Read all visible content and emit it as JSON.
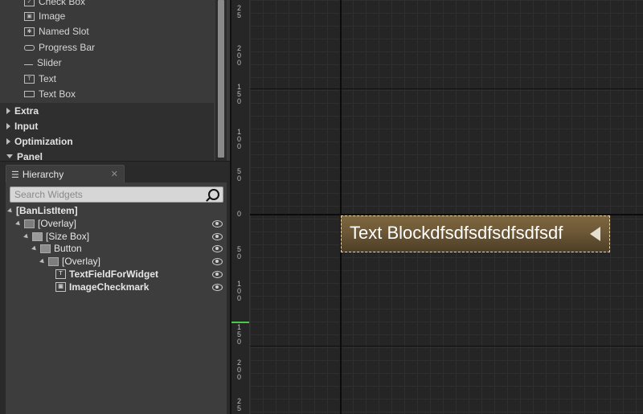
{
  "palette": {
    "items": [
      {
        "label": "Check Box",
        "icon": "checkbox-icon"
      },
      {
        "label": "Image",
        "icon": "image-icon"
      },
      {
        "label": "Named Slot",
        "icon": "named-slot-icon"
      },
      {
        "label": "Progress Bar",
        "icon": "progress-bar-icon"
      },
      {
        "label": "Slider",
        "icon": "slider-icon"
      },
      {
        "label": "Text",
        "icon": "text-icon"
      },
      {
        "label": "Text Box",
        "icon": "textbox-icon"
      }
    ],
    "categories": [
      {
        "label": "Extra",
        "expanded": false
      },
      {
        "label": "Input",
        "expanded": false
      },
      {
        "label": "Optimization",
        "expanded": false
      },
      {
        "label": "Panel",
        "expanded": true
      }
    ]
  },
  "hierarchy": {
    "tab_label": "Hierarchy",
    "search_placeholder": "Search Widgets",
    "nodes": [
      {
        "label": "[BanListItem]"
      },
      {
        "label": "[Overlay]"
      },
      {
        "label": "[Size Box]"
      },
      {
        "label": "Button"
      },
      {
        "label": "[Overlay]"
      },
      {
        "label": "TextFieldForWidget"
      },
      {
        "label": "ImageCheckmark"
      }
    ]
  },
  "ruler": {
    "labels": [
      "2\n5",
      "2\n0\n0",
      "1\n5\n0",
      "1\n0\n0",
      "5\n0",
      "0",
      "5\n0",
      "1\n0\n0",
      "1\n5\n0",
      "2\n0\n0",
      "2\n5"
    ]
  },
  "designer": {
    "widget_text": "Text Blockdfsdfsdfsdfsdfsdf",
    "widget_color": "#6d5837",
    "axis_color": "#0c0c0c",
    "selection_color": "#4ac94a"
  }
}
